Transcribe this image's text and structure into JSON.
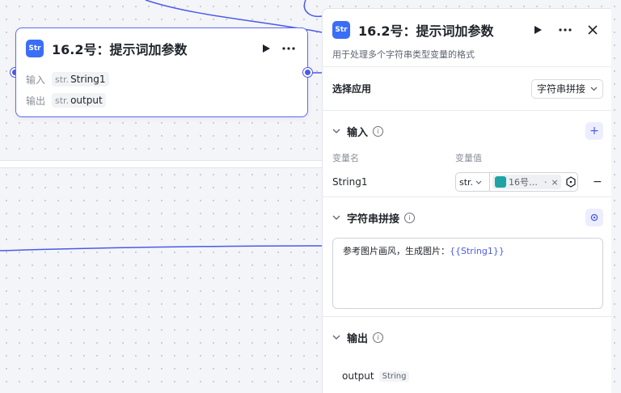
{
  "node": {
    "icon_text": "Str",
    "title": "16.2号：提示词加参数",
    "input_label": "输入",
    "input_type": "str.",
    "input_value": "String1",
    "output_label": "输出",
    "output_type": "str.",
    "output_value": "output"
  },
  "panel": {
    "icon_text": "Str",
    "title": "16.2号：提示词加参数",
    "description": "用于处理多个字符串类型变量的格式",
    "select_app_label": "选择应用",
    "select_app_value": "字符串拼接",
    "input_section": {
      "title": "输入",
      "col_name": "变量名",
      "col_value": "变量值",
      "rows": [
        {
          "name": "String1",
          "type": "str.",
          "ref": "16号…",
          "ref_suffix": "·"
        }
      ]
    },
    "concat_section": {
      "title": "字符串拼接",
      "text_prefix": "参考图片画风，生成图片：",
      "text_var": "{{String1}}"
    },
    "output_section": {
      "title": "输出",
      "var_name": "output",
      "var_type": "String"
    }
  },
  "colors": {
    "accent": "#4c5ae8",
    "icon_blue": "#3b6ef7",
    "ref_teal": "#1ea4a4"
  }
}
